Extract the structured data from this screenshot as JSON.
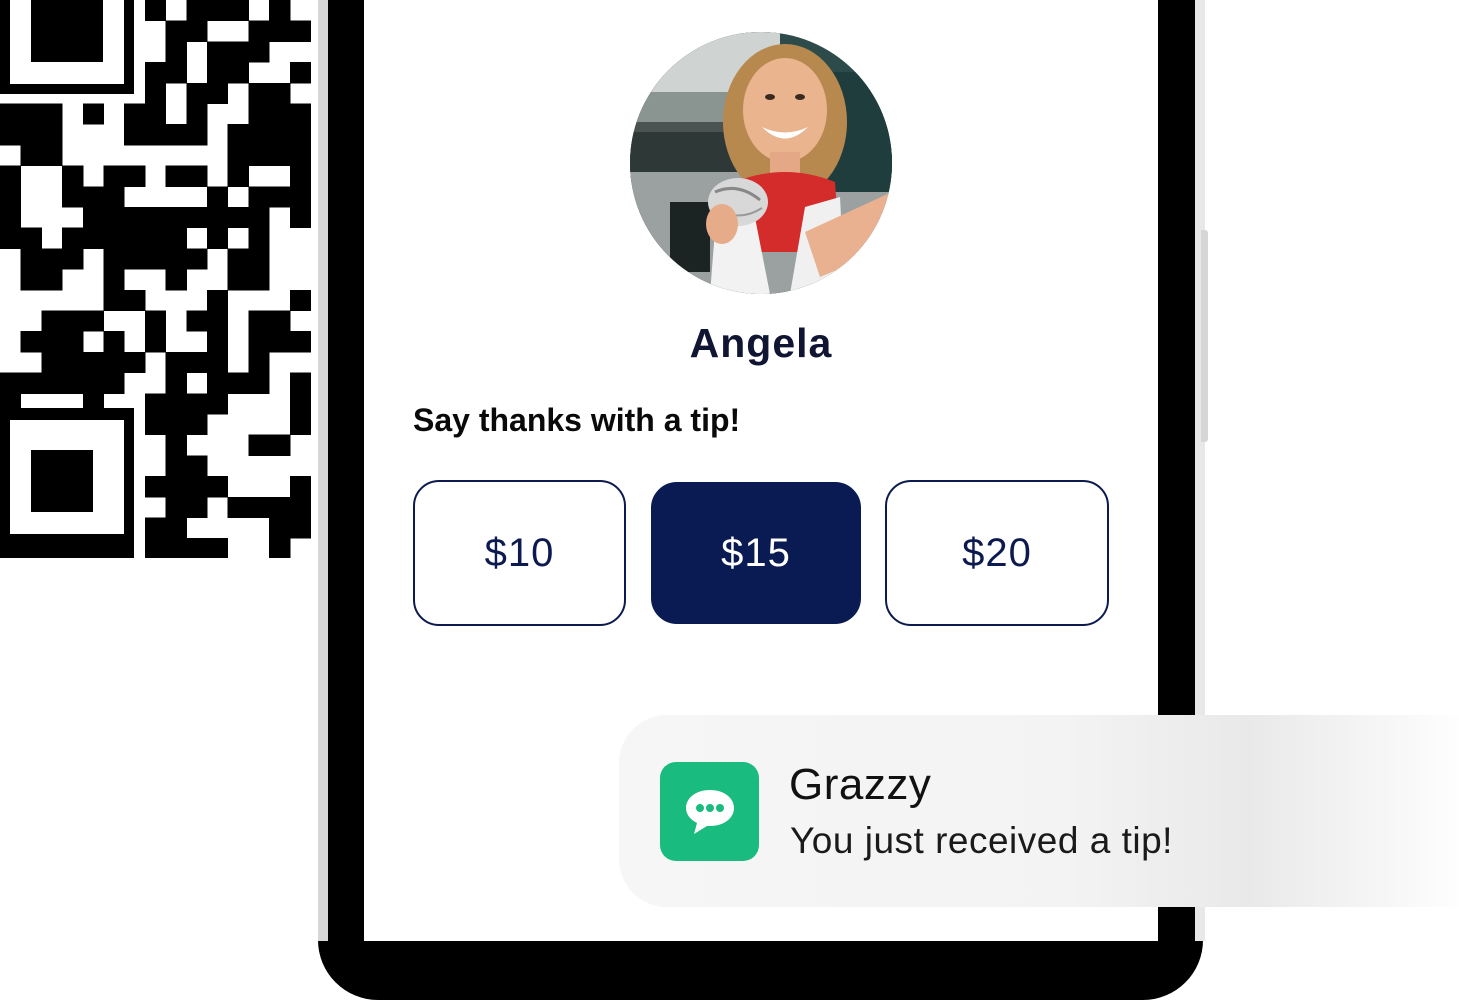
{
  "profile": {
    "name": "Angela",
    "photo_alt": "Angela"
  },
  "tipping": {
    "prompt": "Say thanks with a tip!",
    "options": [
      {
        "label": "$10",
        "selected": false
      },
      {
        "label": "$15",
        "selected": true
      },
      {
        "label": "$20",
        "selected": false
      }
    ]
  },
  "notification": {
    "app_name": "Grazzy",
    "message": "You just received a tip!",
    "icon": "chat-bubble-icon"
  },
  "colors": {
    "navy": "#0a1a52",
    "notification_icon_bg": "#19bb7f"
  }
}
